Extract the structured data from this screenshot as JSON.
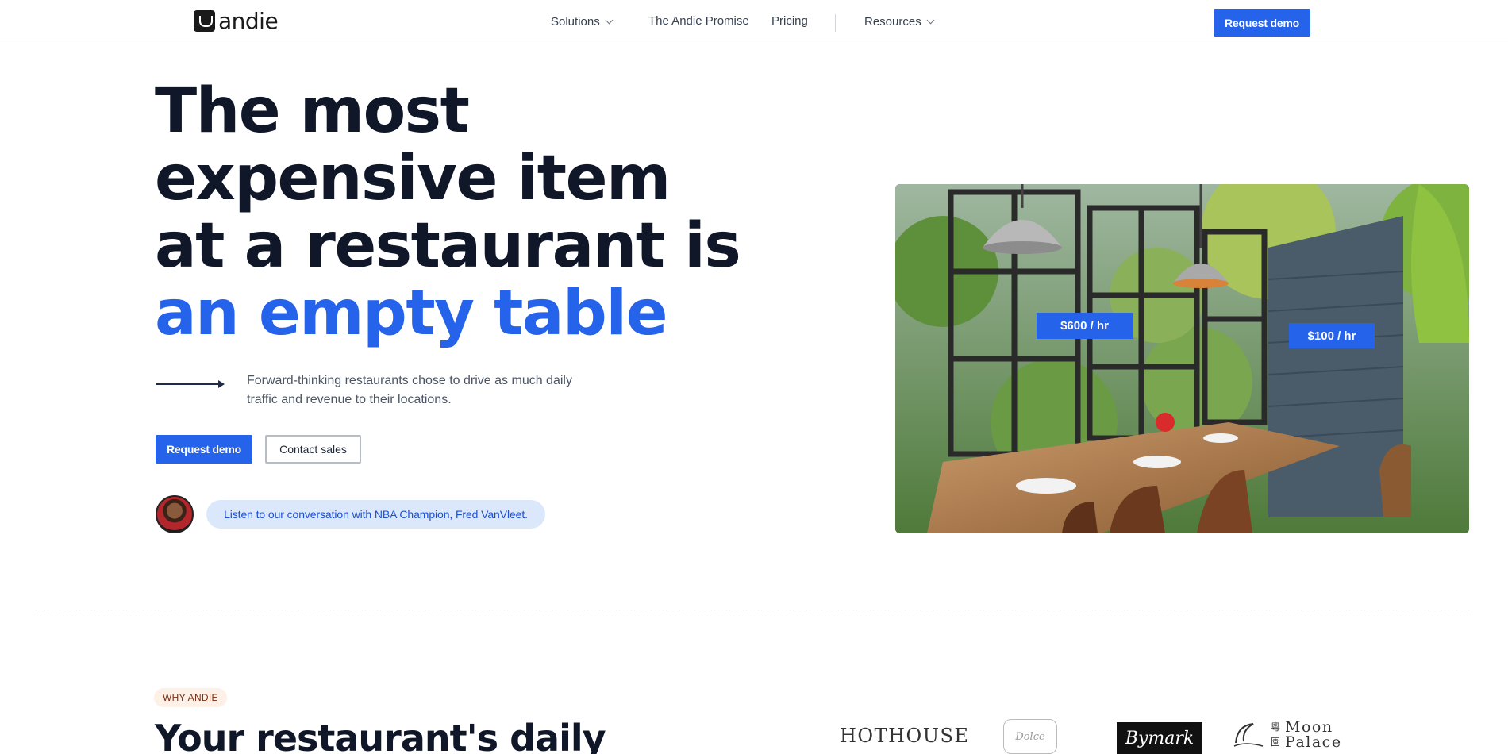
{
  "nav": {
    "logo_text": "andie",
    "links": [
      {
        "label": "Solutions",
        "has_dropdown": true
      },
      {
        "label": "The Andie Promise",
        "has_dropdown": false
      },
      {
        "label": "Pricing",
        "has_dropdown": false
      },
      {
        "label": "Resources",
        "has_dropdown": true
      }
    ],
    "cta_label": "Request demo"
  },
  "hero": {
    "headline_lines": [
      "The most",
      "expensive item",
      "at a restaurant is"
    ],
    "headline_highlight": "an empty table",
    "subtext": "Forward-thinking restaurants chose to drive as much daily traffic and revenue to their locations.",
    "primary_button": "Request demo",
    "secondary_button": "Contact sales",
    "podcast_link": "Listen to our conversation with NBA Champion, Fred VanVleet.",
    "price_tags": [
      "$600 / hr",
      "$100 / hr"
    ]
  },
  "why": {
    "badge": "WHY ANDIE",
    "title": "Your restaurant's daily",
    "brands": [
      "HOTHOUSE",
      "Dolce",
      "Bymark",
      "粵",
      "園",
      "Moon",
      "Palace"
    ]
  },
  "colors": {
    "accent": "#2563eb",
    "heading": "#0f1729",
    "pill_bg": "#dbe8fc",
    "badge_bg": "#fdf0e6"
  }
}
